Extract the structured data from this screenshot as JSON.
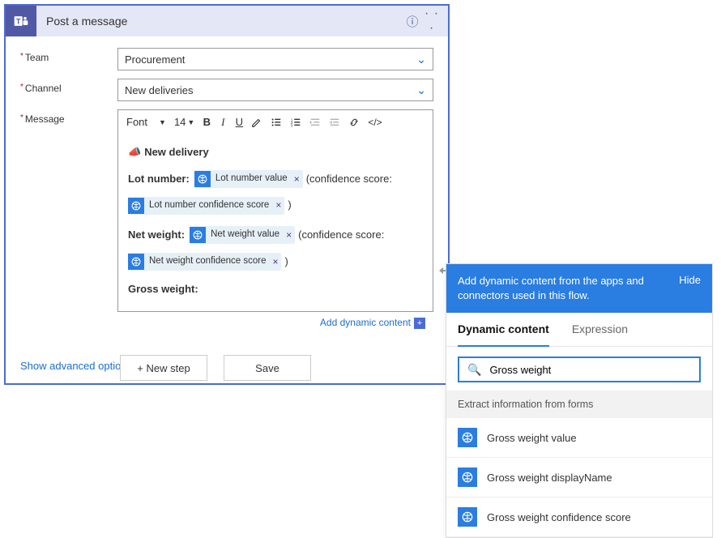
{
  "card": {
    "title": "Post a message",
    "fields": {
      "team": {
        "label": "Team",
        "value": "Procurement"
      },
      "channel": {
        "label": "Channel",
        "value": "New deliveries"
      },
      "message": {
        "label": "Message"
      }
    },
    "toolbar": {
      "font": "Font",
      "size": "14"
    },
    "body": {
      "heading": "New delivery",
      "lot_label": "Lot number:",
      "netw_label": "Net weight:",
      "gross_label": "Gross weight:",
      "conf_text": "(confidence score:",
      "paren_close": ")",
      "tokens": {
        "lot_val": "Lot number value",
        "lot_conf": "Lot number confidence score",
        "net_val": "Net weight value",
        "net_conf": "Net weight confidence score"
      }
    },
    "add_dynamic": "Add dynamic content",
    "advanced": "Show advanced options"
  },
  "footer": {
    "new_step": "+ New step",
    "save": "Save"
  },
  "panel": {
    "header": "Add dynamic content from the apps and connectors used in this flow.",
    "hide": "Hide",
    "tabs": {
      "dynamic": "Dynamic content",
      "expression": "Expression"
    },
    "search_value": "Gross weight",
    "section": "Extract information from forms",
    "results": [
      "Gross weight value",
      "Gross weight displayName",
      "Gross weight confidence score"
    ]
  }
}
